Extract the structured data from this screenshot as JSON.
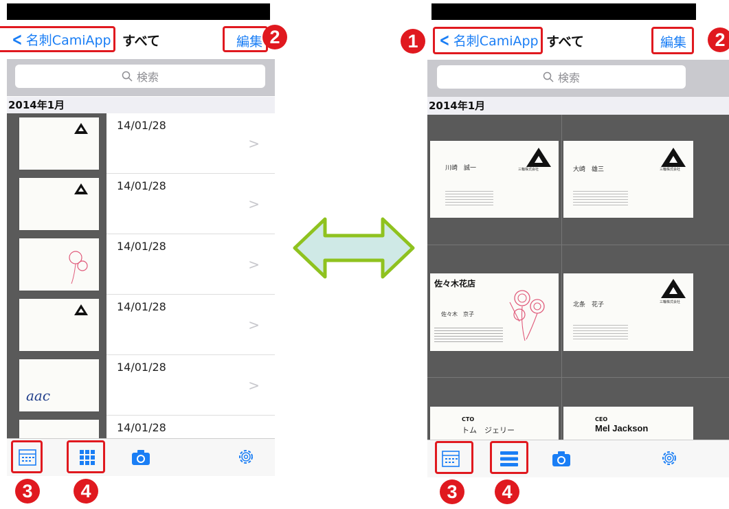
{
  "left": {
    "back_label": "名刺CamiApp",
    "title": "すべて",
    "edit_label": "編集",
    "search_placeholder": "検索",
    "section": "2014年1月",
    "rows": [
      {
        "date": "14/01/28"
      },
      {
        "date": "14/01/28"
      },
      {
        "date": "14/01/28"
      },
      {
        "date": "14/01/28"
      },
      {
        "date": "14/01/28"
      },
      {
        "date": "14/01/28"
      }
    ]
  },
  "right": {
    "back_label": "名刺CamiApp",
    "title": "すべて",
    "edit_label": "編集",
    "search_placeholder": "検索",
    "section": "2014年1月",
    "cards": [
      {
        "name": "川崎　誠一",
        "company": "三輪株式会社"
      },
      {
        "name": "大崎　雄三",
        "company": "三輪株式会社"
      },
      {
        "name": "佐々木　京子",
        "shop": "佐々木花店"
      },
      {
        "name": "北条　花子",
        "company": "三輪株式会社"
      },
      {
        "title": "CTO",
        "name": "トム　ジェリー"
      },
      {
        "title": "CEO",
        "name": "Mel Jackson"
      }
    ]
  },
  "badges": {
    "one": "1",
    "two": "2",
    "three": "3",
    "four": "4"
  },
  "colors": {
    "accent": "#1a7ef5",
    "annotation_red": "#e0191f",
    "arrow_fill": "#cfe9e6",
    "arrow_stroke": "#8fc21f"
  }
}
